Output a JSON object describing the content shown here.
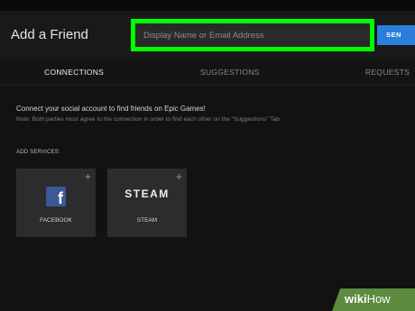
{
  "header": {
    "title": "Add a Friend",
    "search_placeholder": "Display Name or Email Address",
    "search_value": "",
    "send_label": "SEN"
  },
  "tabs": [
    {
      "label": "CONNECTIONS",
      "active": true
    },
    {
      "label": "SUGGESTIONS",
      "active": false
    },
    {
      "label": "REQUESTS",
      "active": false
    }
  ],
  "content": {
    "connect_text": "Connect your social account to find friends on Epic Games!",
    "note_text": "Note: Both parties must agree to the connection in order to find each other on the \"Suggestions\" Tab.",
    "add_services_label": "ADD SERVICES:",
    "services": [
      {
        "name": "FACEBOOK",
        "icon": "facebook-icon",
        "add": "+"
      },
      {
        "name": "STEAM",
        "logo_text": "STEAM",
        "add": "+"
      }
    ]
  },
  "watermark": {
    "wiki": "wiki",
    "how": "How"
  },
  "colors": {
    "highlight": "#00ff00",
    "accent": "#2a7fdc",
    "facebook": "#3b5998"
  }
}
